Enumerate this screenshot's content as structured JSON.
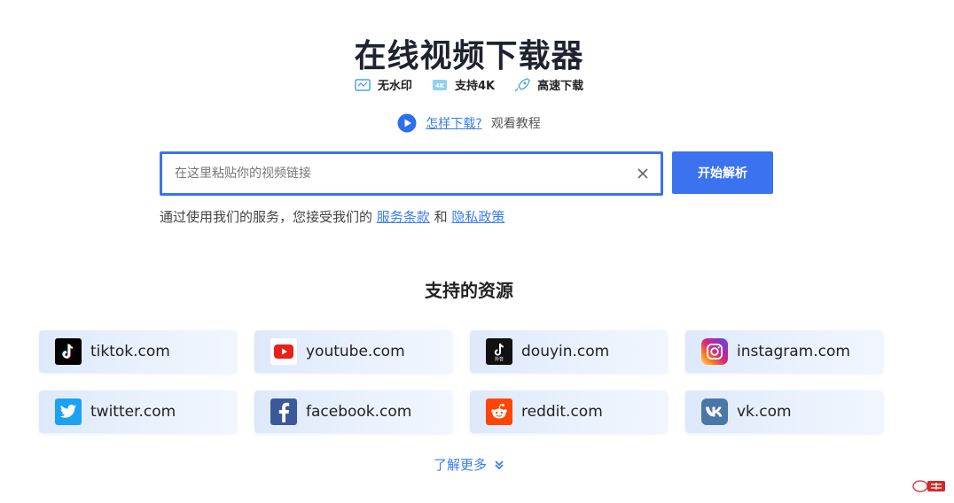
{
  "page": {
    "title": "在线视频下载器",
    "features": [
      {
        "icon": "no-watermark-icon",
        "label": "无水印"
      },
      {
        "icon": "4k-icon",
        "label": "支持4K"
      },
      {
        "icon": "rocket-icon",
        "label": "高速下载"
      }
    ],
    "howto": {
      "link": "怎样下载?",
      "text": "观看教程"
    },
    "search": {
      "placeholder": "在这里粘贴你的视频链接",
      "value": ""
    },
    "start_button": "开始解析",
    "terms": {
      "prefix": "通过使用我们的服务，您接受我们的 ",
      "terms_link": "服务条款",
      "and": " 和 ",
      "privacy_link": "隐私政策"
    },
    "section_title": "支持的资源",
    "sites": [
      {
        "name": "tiktok.com",
        "icon": "tiktok-icon",
        "color": "#000000"
      },
      {
        "name": "youtube.com",
        "icon": "youtube-icon",
        "color": "#e62117"
      },
      {
        "name": "douyin.com",
        "icon": "douyin-icon",
        "color": "#111111"
      },
      {
        "name": "instagram.com",
        "icon": "instagram-icon",
        "color": "#d62976"
      },
      {
        "name": "twitter.com",
        "icon": "twitter-icon",
        "color": "#1da1f2"
      },
      {
        "name": "facebook.com",
        "icon": "facebook-icon",
        "color": "#3b5998"
      },
      {
        "name": "reddit.com",
        "icon": "reddit-icon",
        "color": "#ff4500"
      },
      {
        "name": "vk.com",
        "icon": "vk-icon",
        "color": "#4a76a8"
      }
    ],
    "more": "了解更多",
    "colors": {
      "accent": "#3a72ef",
      "link": "#3a7cf0"
    }
  }
}
